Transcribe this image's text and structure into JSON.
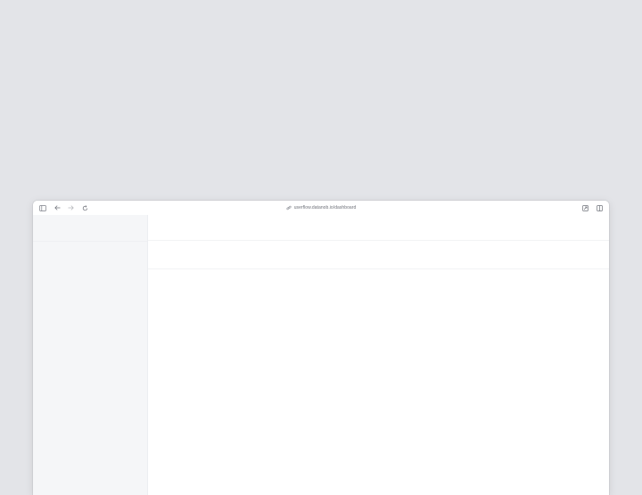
{
  "browser": {
    "url": "userflow.datanob.io/dashboard",
    "icons": {
      "sidebar_toggle": "sidebar-toggle-icon",
      "back": "arrow-left-icon",
      "forward": "arrow-right-icon",
      "reload": "reload-icon",
      "address_lock": "link-icon",
      "share": "share-icon",
      "split_view": "split-view-icon"
    }
  },
  "colors": {
    "background": "#e3e4e8",
    "window": "#ffffff",
    "sidebar": "#f5f6f8",
    "url_text": "#6e7179"
  }
}
